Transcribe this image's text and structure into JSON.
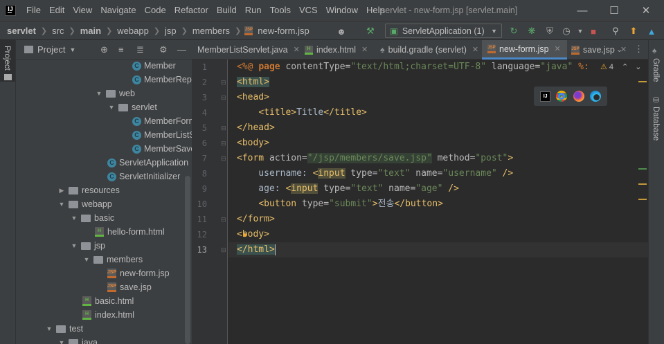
{
  "menubar": {
    "logo": "IJ",
    "items": [
      "File",
      "Edit",
      "View",
      "Navigate",
      "Code",
      "Refactor",
      "Build",
      "Run",
      "Tools",
      "VCS",
      "Window",
      "Help"
    ],
    "title": "servlet - new-form.jsp [servlet.main]"
  },
  "breadcrumb": [
    "servlet",
    "src",
    "main",
    "webapp",
    "jsp",
    "members",
    "new-form.jsp"
  ],
  "toolbar": {
    "run_config": "ServletApplication (1)"
  },
  "left_strip": {
    "project_tab": "Project"
  },
  "right_strip": {
    "gradle_tab": "Gradle",
    "database_tab": "Database"
  },
  "project_panel": {
    "title": "Project",
    "tree": [
      {
        "label": "Member",
        "kind": "class"
      },
      {
        "label": "MemberRepo",
        "kind": "class"
      },
      {
        "label": "web",
        "kind": "package"
      },
      {
        "label": "servlet",
        "kind": "package"
      },
      {
        "label": "MemberForm",
        "kind": "class"
      },
      {
        "label": "MemberListS",
        "kind": "class"
      },
      {
        "label": "MemberSave",
        "kind": "class"
      },
      {
        "label": "ServletApplication",
        "kind": "class"
      },
      {
        "label": "ServletInitializer",
        "kind": "class"
      },
      {
        "label": "resources",
        "kind": "folder"
      },
      {
        "label": "webapp",
        "kind": "folder"
      },
      {
        "label": "basic",
        "kind": "folder"
      },
      {
        "label": "hello-form.html",
        "kind": "html"
      },
      {
        "label": "jsp",
        "kind": "folder"
      },
      {
        "label": "members",
        "kind": "folder"
      },
      {
        "label": "new-form.jsp",
        "kind": "jsp"
      },
      {
        "label": "save.jsp",
        "kind": "jsp"
      },
      {
        "label": "basic.html",
        "kind": "html"
      },
      {
        "label": "index.html",
        "kind": "html"
      },
      {
        "label": "test",
        "kind": "folder"
      },
      {
        "label": "java",
        "kind": "folder"
      }
    ]
  },
  "tabs": [
    {
      "label": "MemberListServlet.java",
      "active": false
    },
    {
      "label": "index.html",
      "active": false
    },
    {
      "label": "build.gradle (servlet)",
      "active": false
    },
    {
      "label": "new-form.jsp",
      "active": true
    },
    {
      "label": "save.jsp",
      "active": false
    }
  ],
  "editor": {
    "warnings": "4",
    "line_numbers": [
      "1",
      "2",
      "3",
      "4",
      "5",
      "6",
      "7",
      "8",
      "9",
      "10",
      "11",
      "12",
      "13"
    ],
    "lines": {
      "l1a": "<%@ ",
      "l1b": "page",
      "l1c": " contentType=",
      "l1d": "\"text/html;charset=UTF-8\"",
      "l1e": " language=",
      "l1f": "\"java\"",
      "l1g": " %:",
      "l2": "<html>",
      "l3": "<head>",
      "l4a": "    ",
      "l4b": "<title>",
      "l4c": "Title",
      "l4d": "</title>",
      "l5": "</head>",
      "l6": "<body>",
      "l7a": "<form ",
      "l7b": "action=",
      "l7c": "\"/jsp/members/save.jsp\"",
      "l7d": " method=",
      "l7e": "\"post\"",
      "l7f": ">",
      "l8a": "    username: ",
      "l8b": "<",
      "l8c": "input",
      "l8d": " type=",
      "l8e": "\"text\"",
      "l8f": " name=",
      "l8g": "\"username\"",
      "l8h": " />",
      "l9a": "    age: ",
      "l9b": "<",
      "l9c": "input",
      "l9d": " type=",
      "l9e": "\"text\"",
      "l9f": " name=",
      "l9g": "\"age\"",
      "l9h": " />",
      "l10a": "    ",
      "l10b": "<button ",
      "l10c": "type=",
      "l10d": "\"submit\"",
      "l10e": ">",
      "l10f": "전송",
      "l10g": "</button>",
      "l11": "</form>",
      "l12a": "<",
      "l12b": "body>",
      "l13": "</html>"
    }
  }
}
